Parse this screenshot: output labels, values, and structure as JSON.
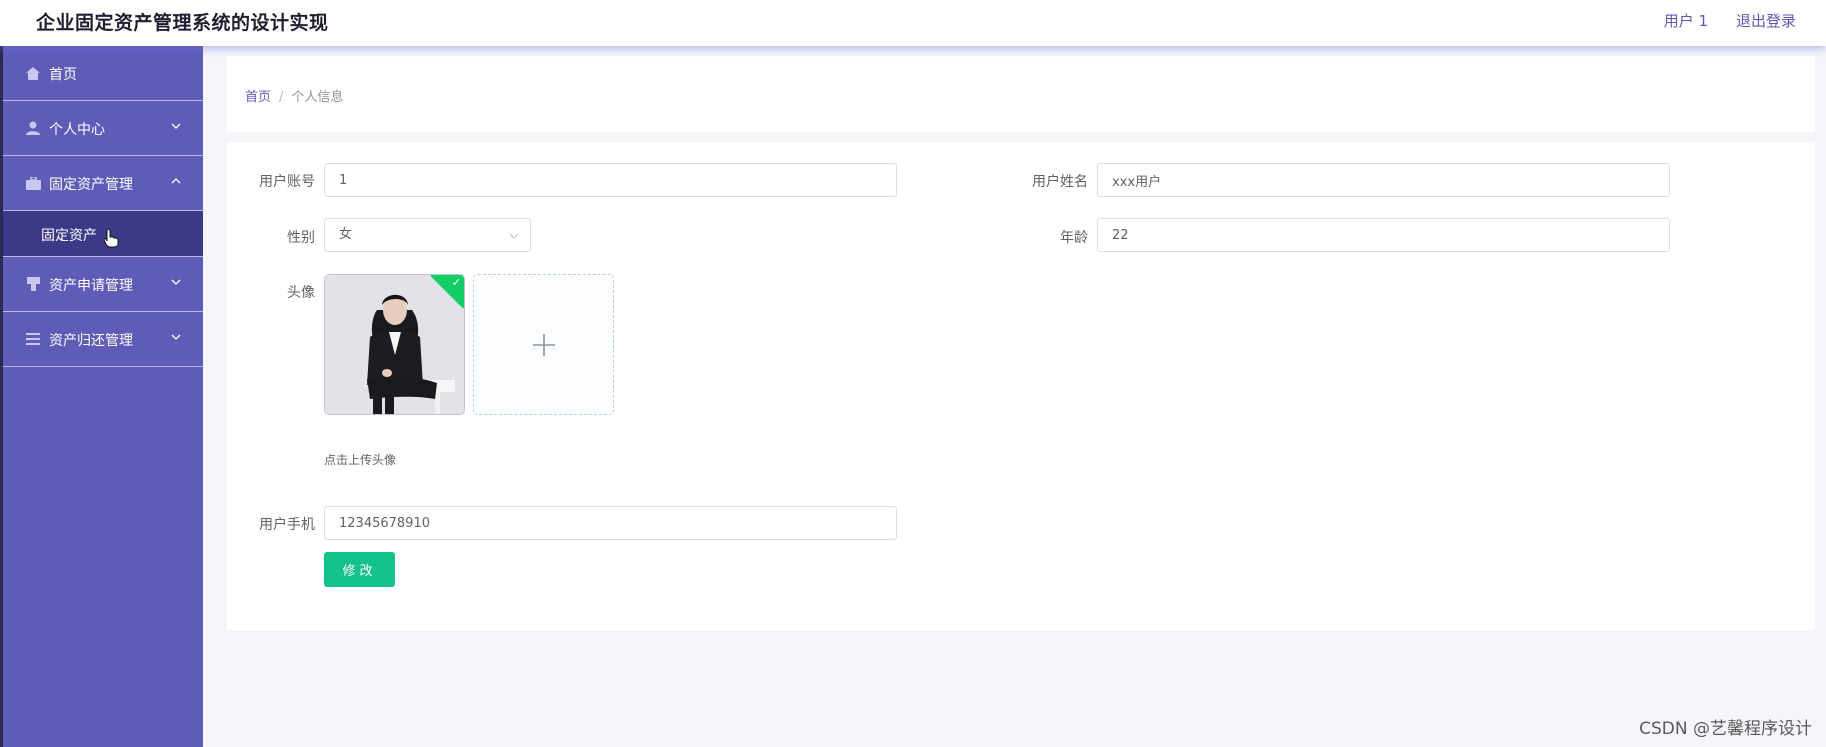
{
  "header": {
    "title": "企业固定资产管理系统的设计实现",
    "user": "用户 1",
    "logout": "退出登录"
  },
  "sidebar": {
    "items": [
      {
        "label": "首页",
        "icon": "home-icon"
      },
      {
        "label": "个人中心",
        "icon": "user-icon"
      },
      {
        "label": "固定资产管理",
        "icon": "briefcase-icon"
      },
      {
        "label": "资产申请管理",
        "icon": "stamp-icon"
      },
      {
        "label": "资产归还管理",
        "icon": "list-icon"
      }
    ],
    "sub_items": [
      {
        "label": "固定资产"
      }
    ]
  },
  "breadcrumb": {
    "home": "首页",
    "separator": "/",
    "current": "个人信息"
  },
  "form": {
    "account_label": "用户账号",
    "account_value": "1",
    "name_label": "用户姓名",
    "name_value": "xxx用户",
    "gender_label": "性别",
    "gender_value": "女",
    "age_label": "年龄",
    "age_value": "22",
    "avatar_label": "头像",
    "avatar_hint": "点击上传头像",
    "phone_label": "用户手机",
    "phone_value": "12345678910",
    "submit_label": "修改"
  },
  "watermark": "CSDN @艺馨程序设计",
  "colors": {
    "sidebar": "#5f5cb8",
    "sidebar_active": "#3c3a88",
    "primary": "#13c28b",
    "accent": "#5f5cb8"
  }
}
